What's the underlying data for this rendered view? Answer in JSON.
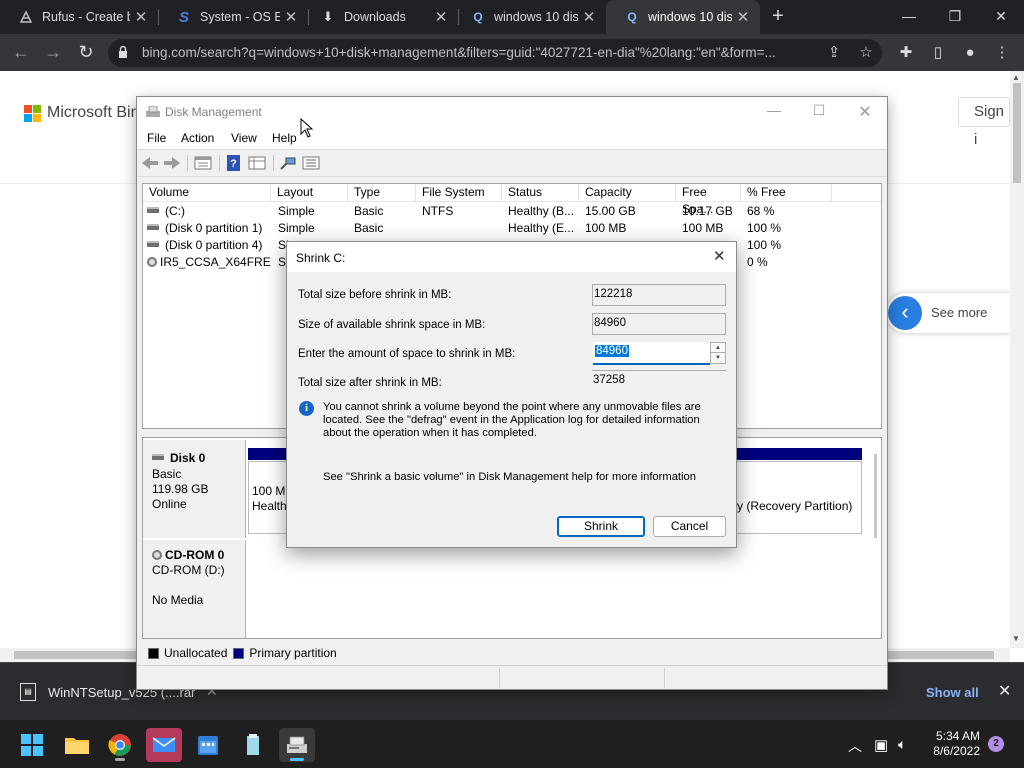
{
  "browser": {
    "tabs": [
      {
        "title": "Rufus - Create b",
        "icon": "rufus-icon"
      },
      {
        "title": "System - OS En",
        "icon": "s-logo-icon"
      },
      {
        "title": "Downloads",
        "icon": "download-icon"
      },
      {
        "title": "windows 10 disk",
        "icon": "search-icon"
      },
      {
        "title": "windows 10 disk",
        "icon": "search-icon"
      }
    ],
    "url": "bing.com/search?q=windows+10+disk+management&filters=guid:\"4027721-en-dia\"%20lang:\"en\"&form=...",
    "page": {
      "logo_text": "Microsoft Bing",
      "sign_in": "Sign i",
      "see_more": "See more"
    },
    "download": {
      "file_name": "WinNTSetup_v525 (....rar",
      "show_all": "Show all"
    }
  },
  "disk_management": {
    "title": "Disk Management",
    "menu": [
      "File",
      "Action",
      "View",
      "Help"
    ],
    "columns": [
      "Volume",
      "Layout",
      "Type",
      "File System",
      "Status",
      "Capacity",
      "Free Spa...",
      "% Free"
    ],
    "volumes": [
      {
        "volume": "(C:)",
        "layout": "Simple",
        "type": "Basic",
        "fs": "NTFS",
        "status": "Healthy (B...",
        "capacity": "15.00 GB",
        "free": "10.17 GB",
        "pct": "68 %"
      },
      {
        "volume": "(Disk 0 partition 1)",
        "layout": "Simple",
        "type": "Basic",
        "fs": "",
        "status": "Healthy (E...",
        "capacity": "100 MB",
        "free": "100 MB",
        "pct": "100 %"
      },
      {
        "volume": "(Disk 0 partition 4)",
        "layout": "Si",
        "type": "",
        "fs": "",
        "status": "",
        "capacity": "",
        "free": "",
        "pct": "100 %"
      },
      {
        "volume": "IR5_CCSA_X64FRE...",
        "layout": "Si",
        "type": "",
        "fs": "",
        "status": "",
        "capacity": "",
        "free": "",
        "pct": "0 %"
      }
    ],
    "disk0": {
      "name": "Disk 0",
      "type": "Basic",
      "size": "119.98 GB",
      "state": "Online",
      "part1_line1": "100 M",
      "part1_line2": "Health",
      "part_last": "y (Recovery Partition)"
    },
    "cdrom": {
      "name": "CD-ROM 0",
      "drive": "CD-ROM (D:)",
      "media": "No Media"
    },
    "legend": {
      "unallocated": "Unallocated",
      "primary": "Primary partition"
    }
  },
  "shrink_dialog": {
    "title": "Shrink C:",
    "fields": {
      "total_before_label": "Total size before shrink in MB:",
      "total_before_value": "122218",
      "available_label": "Size of available shrink space in MB:",
      "available_value": "84960",
      "amount_label": "Enter the amount of space to shrink in MB:",
      "amount_value": "84960",
      "total_after_label": "Total size after shrink in MB:",
      "total_after_value": "37258"
    },
    "info_text": "You cannot shrink a volume beyond the point where any unmovable files are located. See the \"defrag\" event in the Application log for detailed information about the operation when it has completed.",
    "help_text": "See \"Shrink a basic volume\" in Disk Management help for more information",
    "shrink_button": "Shrink",
    "cancel_button": "Cancel"
  },
  "taskbar": {
    "time": "5:34 AM",
    "date": "8/6/2022",
    "notifications": "2"
  },
  "colors": {
    "chrome_dark": "#202124",
    "primary_partition": "#00007f",
    "accent": "#0067c0"
  }
}
